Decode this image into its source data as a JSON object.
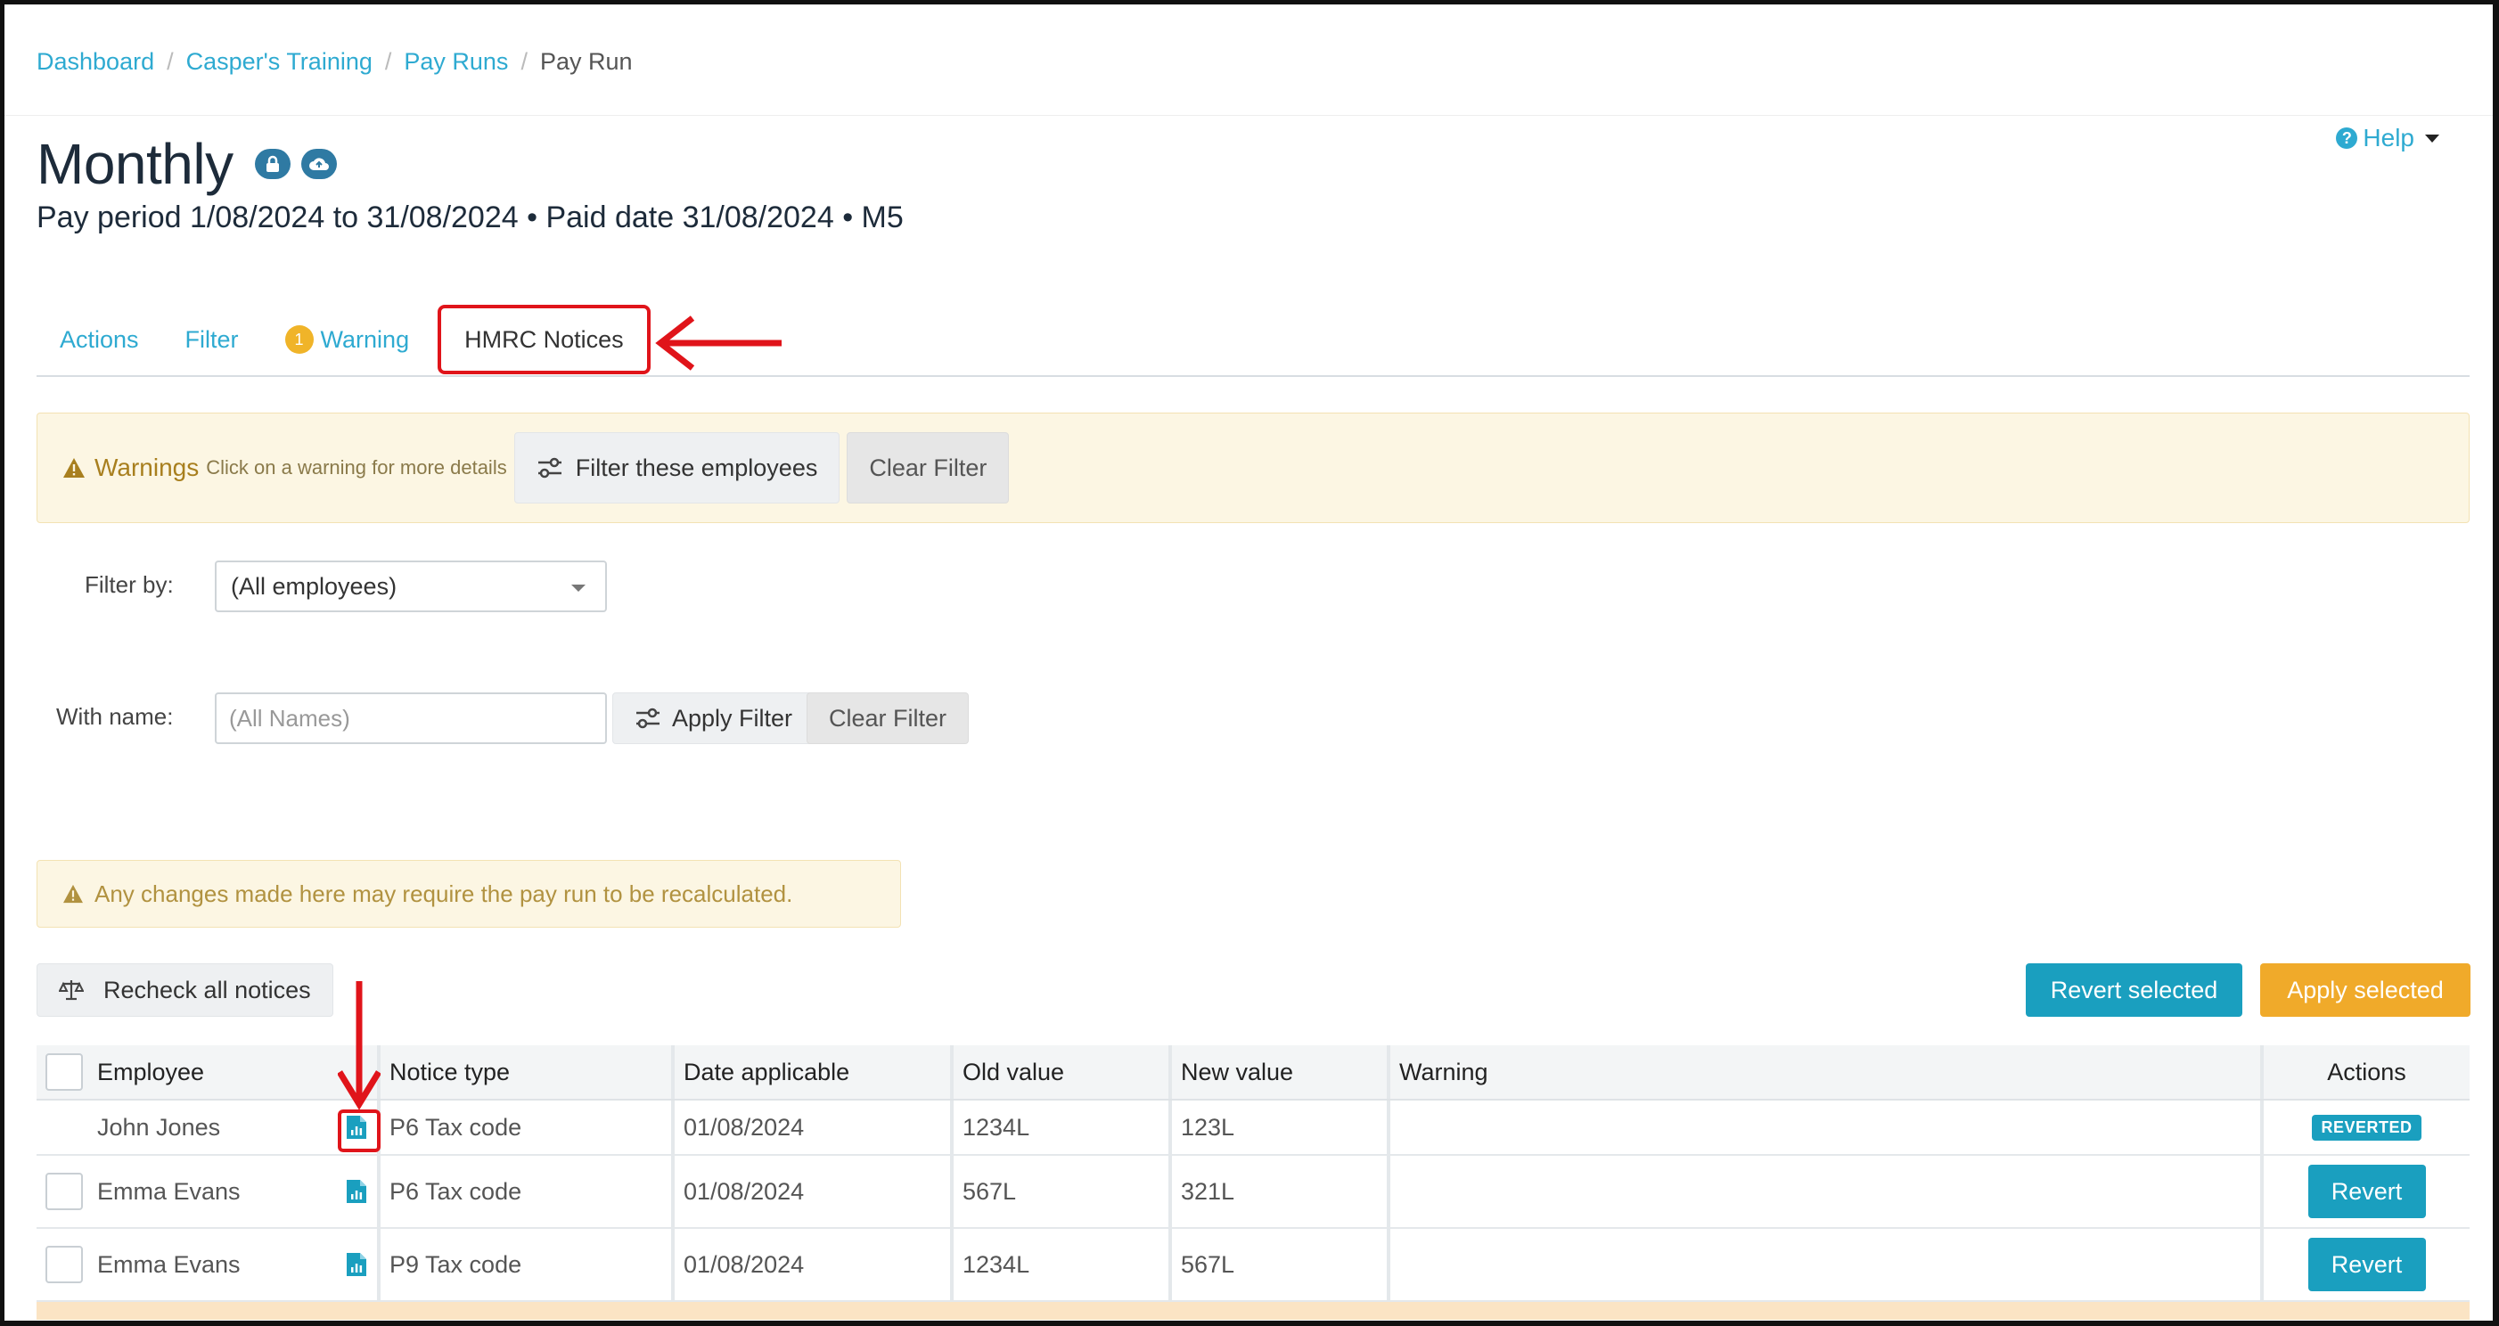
{
  "breadcrumb": {
    "items": [
      "Dashboard",
      "Casper's Training",
      "Pay Runs"
    ],
    "current": "Pay Run",
    "separator": "/"
  },
  "header": {
    "title": "Monthly",
    "subtitle": "Pay period 1/08/2024 to 31/08/2024 • Paid date 31/08/2024 • M5",
    "help_label": "Help"
  },
  "tabs": {
    "actions": "Actions",
    "filter": "Filter",
    "warning": "Warning",
    "warning_count": "1",
    "hmrc": "HMRC Notices"
  },
  "warnings_bar": {
    "title": "Warnings",
    "subtitle": "Click on a warning for more details",
    "filter_button": "Filter these employees",
    "clear_button": "Clear Filter"
  },
  "filters": {
    "filter_by_label": "Filter by:",
    "filter_by_value": "(All employees)",
    "with_name_label": "With name:",
    "name_placeholder": "(All Names)",
    "apply_button": "Apply Filter",
    "clear_button": "Clear Filter"
  },
  "notice": {
    "recalc_text": "Any changes made here may require the pay run to be recalculated."
  },
  "toolbar": {
    "recheck_label": "Recheck all notices",
    "revert_selected": "Revert selected",
    "apply_selected": "Apply selected"
  },
  "table": {
    "headers": [
      "Employee",
      "Notice type",
      "Date applicable",
      "Old value",
      "New value",
      "Warning",
      "Actions"
    ],
    "rows": [
      {
        "employee": "John Jones",
        "notice_type": "P6 Tax code",
        "date": "01/08/2024",
        "old": "1234L",
        "new": "123L",
        "warning": "",
        "action": "REVERTED"
      },
      {
        "employee": "Emma Evans",
        "notice_type": "P6 Tax code",
        "date": "01/08/2024",
        "old": "567L",
        "new": "321L",
        "warning": "",
        "action": "Revert"
      },
      {
        "employee": "Emma Evans",
        "notice_type": "P9 Tax code",
        "date": "01/08/2024",
        "old": "1234L",
        "new": "567L",
        "warning": "",
        "action": "Revert"
      }
    ]
  },
  "colors": {
    "link": "#2eaad1",
    "teal_button": "#1a9fbf",
    "amber_button": "#f0aa2a",
    "warning_bg": "#fcf6e3",
    "annotation_red": "#e0141a"
  },
  "icons": [
    "lock-icon",
    "cloud-sync-icon",
    "help-icon",
    "warning-triangle-icon",
    "sliders-icon",
    "scales-icon",
    "notice-document-icon",
    "annotation-arrow"
  ]
}
